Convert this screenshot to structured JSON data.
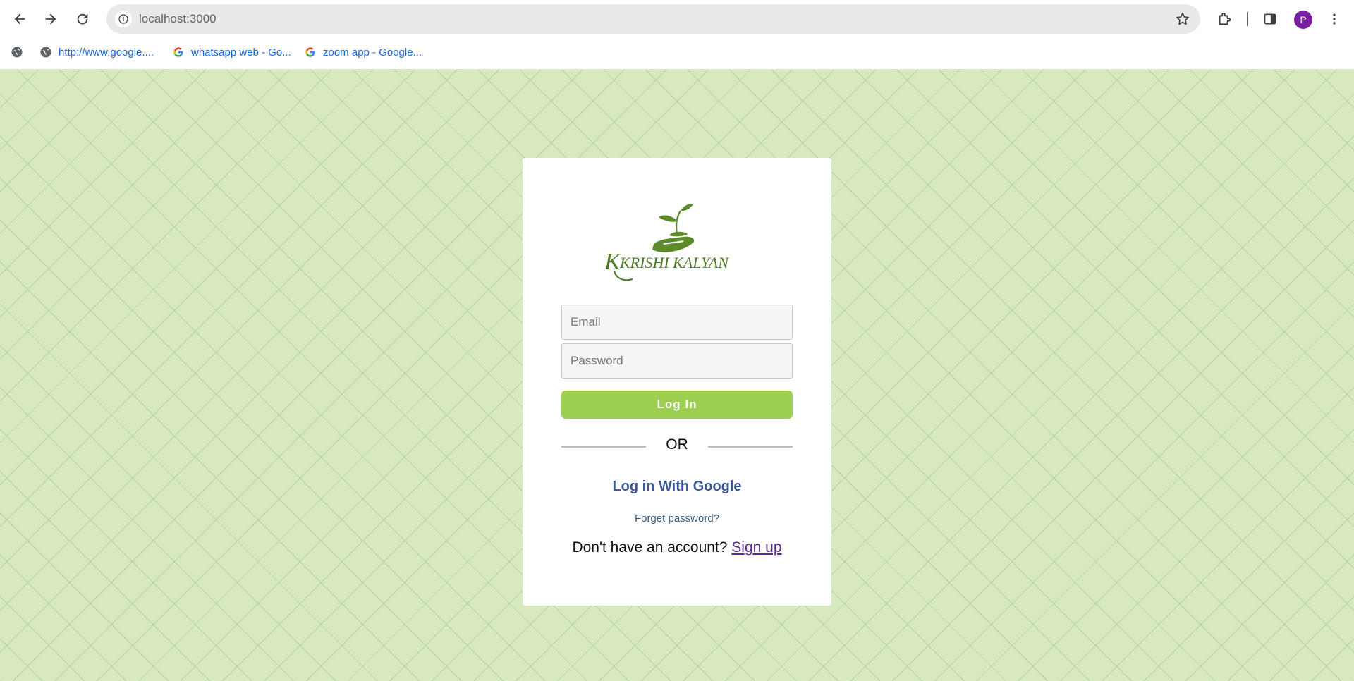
{
  "browser": {
    "url": "localhost:3000",
    "profile_initial": "P",
    "bookmarks": [
      {
        "label": "",
        "icon": "globe-icon"
      },
      {
        "label": "http://www.google....",
        "icon": "globe-icon"
      },
      {
        "label": "whatsapp web - Go...",
        "icon": "google-icon"
      },
      {
        "label": "zoom app - Google...",
        "icon": "google-icon"
      }
    ]
  },
  "login": {
    "logo_text": "KRISHI KALYAN",
    "email_placeholder": "Email",
    "password_placeholder": "Password",
    "login_button": "Log In",
    "or_text": "OR",
    "google_link": "Log in With Google",
    "forgot_link": "Forget password?",
    "no_account_text": "Don't have an account?",
    "signup_link": "Sign up"
  },
  "colors": {
    "page_bg": "#d8e9bd",
    "login_button": "#9ccf50",
    "google_link": "#3b5998",
    "logo_green": "#5d8a2c"
  }
}
